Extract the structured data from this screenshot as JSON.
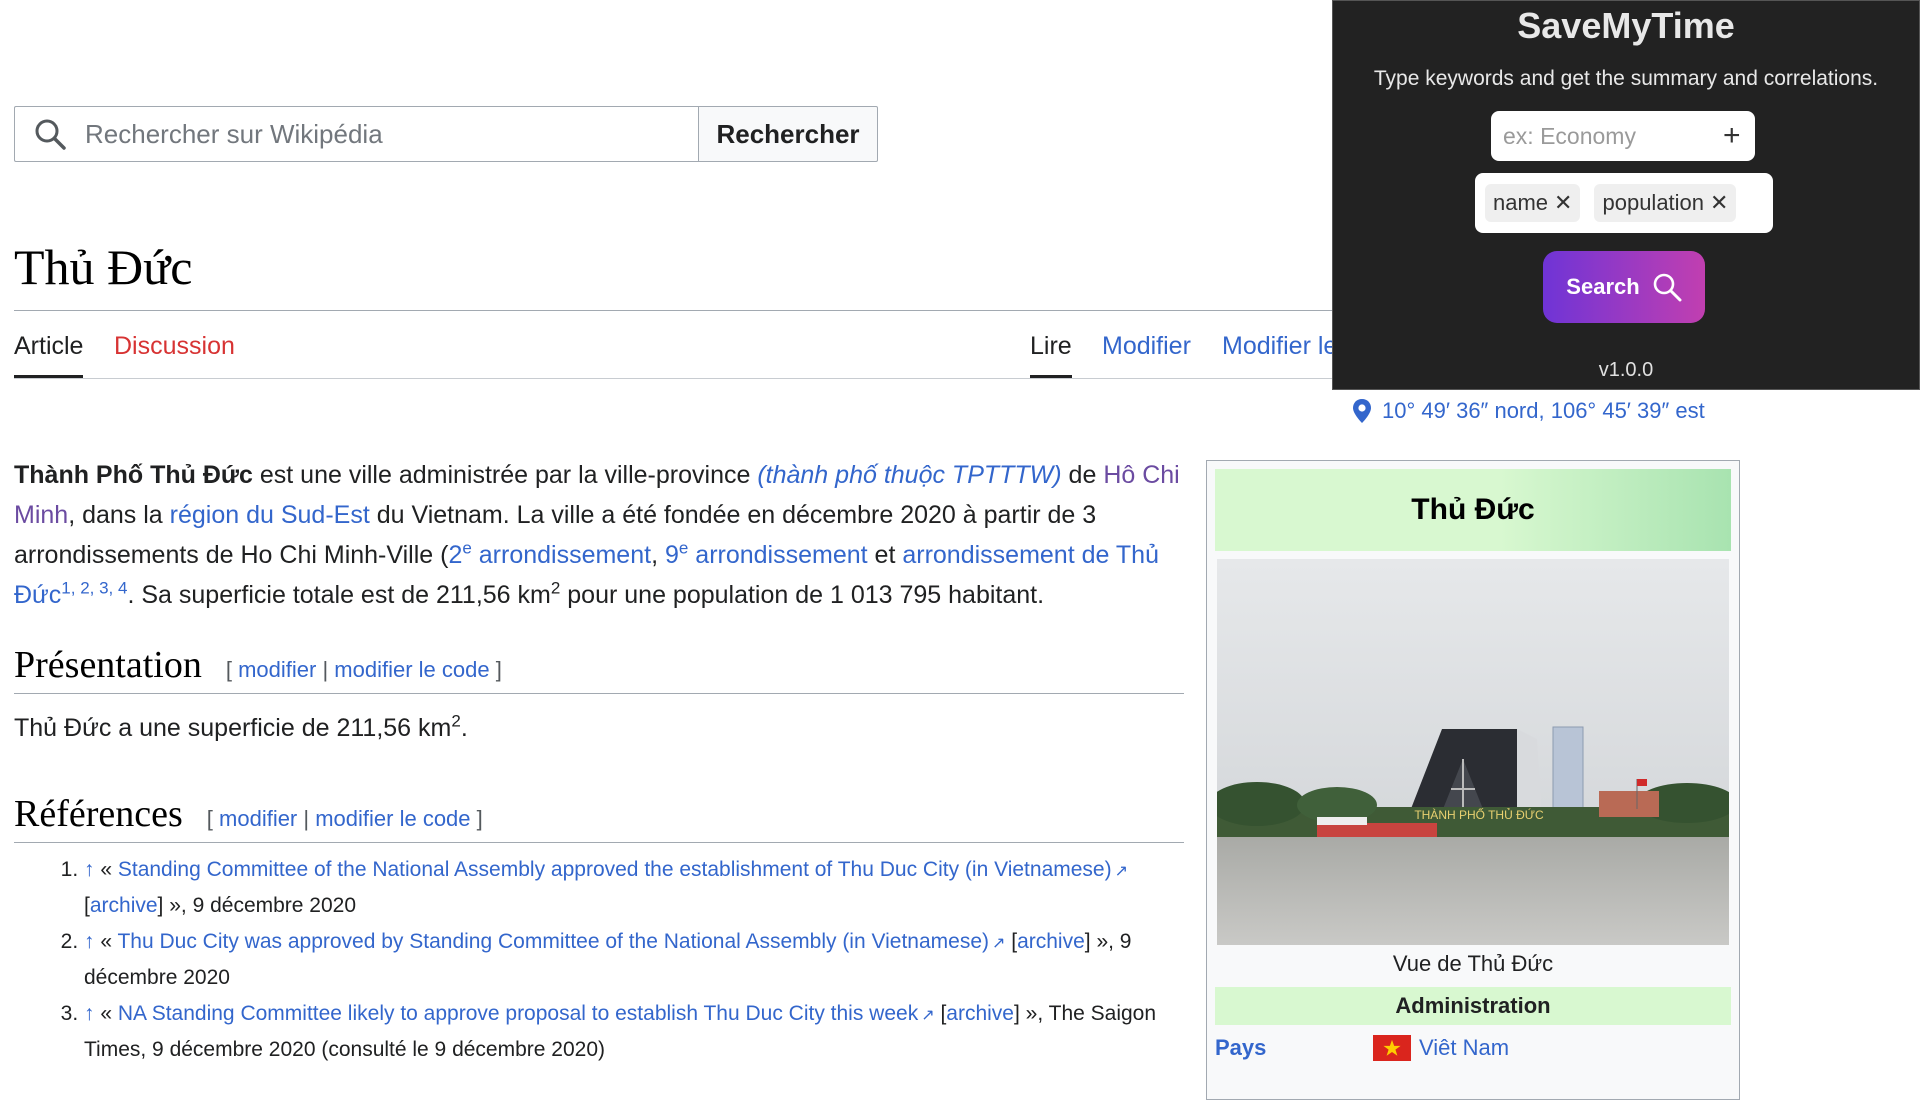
{
  "search": {
    "placeholder": "Rechercher sur Wikipédia",
    "button": "Rechercher"
  },
  "page_title": "Thủ Đức",
  "tabs": {
    "article": "Article",
    "discussion": "Discussion",
    "read": "Lire",
    "edit": "Modifier",
    "edit_code": "Modifier le code"
  },
  "coordinates": "10° 49′ 36″ nord, 106° 45′ 39″ est",
  "intro": {
    "bold": "Thành Phố Thủ Đức",
    "t1": " est une ville administrée par la ville-province ",
    "l_tp": "(thành phố thuộc TPTTTW)",
    "t2": " de ",
    "l_hcm": "Hô Chi Minh",
    "t3": ", dans la ",
    "l_region": "région du Sud-Est",
    "t4": " du Vietnam. La ville a été fondée en décembre 2020 à partir de 3 arrondissements de Ho Chi Minh-Ville (",
    "l_arr2": "2",
    "sup_e1": "e",
    "l_arr2b": " arrondissement",
    "t5": ", ",
    "l_arr9": "9",
    "sup_e2": "e",
    "l_arr9b": " arrondissement",
    "t6": " et ",
    "l_arrtd": "arrondissement de Thủ Đức",
    "refs": "1, 2, 3, 4",
    "t7": ". Sa superficie totale est de 211,56 km",
    "sup2": "2",
    "t8": " pour une population de 1 013 795 habitant."
  },
  "presentation": {
    "heading": "Présentation",
    "edit": "modifier",
    "edit_code": "modifier le code",
    "text": "Thủ Đức a une superficie de 211,56 km",
    "sup": "2",
    "end": "."
  },
  "references": {
    "heading": "Références",
    "edit": "modifier",
    "edit_code": "modifier le code",
    "items": [
      {
        "num": "1.",
        "arrow": "↑",
        "open": " « ",
        "link": "Standing Committee of the National Assembly approved the establishment of Thu Duc City (in Vietnamese)",
        "archive": "archive",
        "rest": " », 9 décembre 2020"
      },
      {
        "num": "2.",
        "arrow": "↑",
        "open": " « ",
        "link": "Thu Duc City was approved by Standing Committee of the National Assembly (in Vietnamese)",
        "archive": "archive",
        "rest": " », 9 décembre 2020"
      },
      {
        "num": "3.",
        "arrow": "↑",
        "open": " « ",
        "link": "NA Standing Committee likely to approve proposal to establish Thu Duc City this week",
        "archive": "archive",
        "rest": " », The Saigon Times, 9 décembre 2020 (consulté le 9 décembre 2020)"
      }
    ]
  },
  "infobox": {
    "title": "Thủ Đức",
    "photo_sign": "THÀNH PHỐ THỦ ĐỨC",
    "caption": "Vue de Thủ Đức",
    "admin_header": "Administration",
    "country_label": "Pays",
    "country_value": "Viêt Nam"
  },
  "extension": {
    "title": "SaveMyTime",
    "subtitle": "Type keywords and get the summary and correlations.",
    "input_placeholder": "ex: Economy",
    "add_label": "+",
    "tags": [
      "name",
      "population"
    ],
    "remove_label": "✕",
    "search_label": "Search",
    "version": "v1.0.0",
    "colors": {
      "bg": "#222222",
      "gradient_start": "#6f34d6",
      "gradient_end": "#c13fb0"
    }
  },
  "colors": {
    "link": "#3366cc",
    "visited": "#6b4ba1",
    "red_link": "#d73333",
    "infobox_green": "#d8f8d0"
  }
}
